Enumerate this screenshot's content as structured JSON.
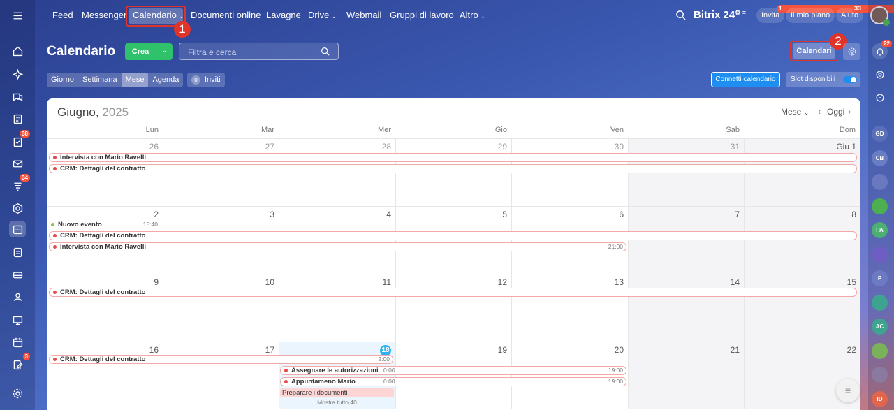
{
  "topnav": {
    "items": [
      "Feed",
      "Messenger",
      "Calendario",
      "Documenti online",
      "Lavagne",
      "Drive",
      "Webmail",
      "Gruppi di lavoro",
      "Altro"
    ],
    "brand": "Bitrix",
    "brand_num": "24",
    "invite": "Invita",
    "invite_badge": "1",
    "plan": "Il mio piano",
    "help": "Aiuto",
    "help_badge": "33"
  },
  "page": {
    "title": "Calendario",
    "create_label": "Crea",
    "search_placeholder": "Filtra e cerca",
    "calendars_btn": "Calendari",
    "views": [
      "Giorno",
      "Settimana",
      "Mese",
      "Agenda"
    ],
    "invites_count": "0",
    "invites_label": "Inviti",
    "connect_btn": "Connetti calendario",
    "slots_label": "Slot disponibili"
  },
  "calendar": {
    "month": "Giugno,",
    "year": "2025",
    "mode": "Mese",
    "today_label": "Oggi",
    "weekdays": [
      "Lun",
      "Mar",
      "Mer",
      "Gio",
      "Ven",
      "Sab",
      "Dom"
    ],
    "weeks": [
      [
        "26",
        "27",
        "28",
        "29",
        "30",
        "31",
        "Giu 1"
      ],
      [
        "2",
        "3",
        "4",
        "5",
        "6",
        "7",
        "8"
      ],
      [
        "9",
        "10",
        "11",
        "12",
        "13",
        "14",
        "15"
      ],
      [
        "16",
        "17",
        "18",
        "19",
        "20",
        "21",
        "22"
      ]
    ],
    "today_date": "18",
    "events": {
      "w1a": "Intervista con Mario Ravelli",
      "w1b": "CRM: Dettagli del contratto",
      "w2a": "Nuovo evento",
      "w2a_time": "15:40",
      "w2b": "CRM: Dettagli del contratto",
      "w2c": "Intervista con Mario Ravelli",
      "w2c_time": "21:00",
      "w3a": "CRM: Dettagli del contratto",
      "w4a": "CRM: Dettagli del contratto",
      "w4_time_a": "2:00",
      "w4b": "Assegnare le autorizzazioni",
      "w4b_start": "0:00",
      "w4b_end": "19:00",
      "w4c": "Appuntameno Mario",
      "w4c_start": "0:00",
      "w4c_end": "19:00",
      "w4d": "Preparare i documenti",
      "w4_more": "Mostra tutto 40"
    }
  },
  "sidebar_badges": {
    "tasks": "38",
    "feed": "34",
    "last": "3"
  },
  "right_sidebar": {
    "notif_badge": "22",
    "avatars": [
      "GD",
      "CB",
      "",
      "",
      "PA",
      "",
      "P",
      "",
      "AC",
      "",
      "",
      "ID"
    ]
  },
  "annotations": [
    "1",
    "2"
  ]
}
